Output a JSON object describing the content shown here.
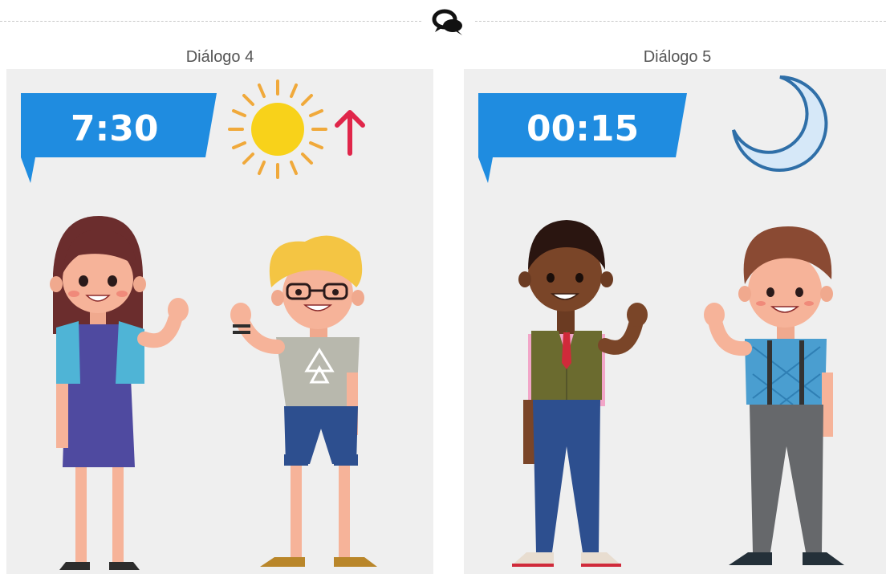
{
  "divider": {
    "icon": "chat-bubbles-icon"
  },
  "dialogs": [
    {
      "title": "Diálogo 4",
      "time": "7:30",
      "icons": [
        "sun-icon",
        "arrow-up-icon"
      ],
      "accent": "#1f8ce0"
    },
    {
      "title": "Diálogo 5",
      "time": "00:15",
      "icons": [
        "moon-icon"
      ],
      "accent": "#1f8ce0"
    }
  ]
}
